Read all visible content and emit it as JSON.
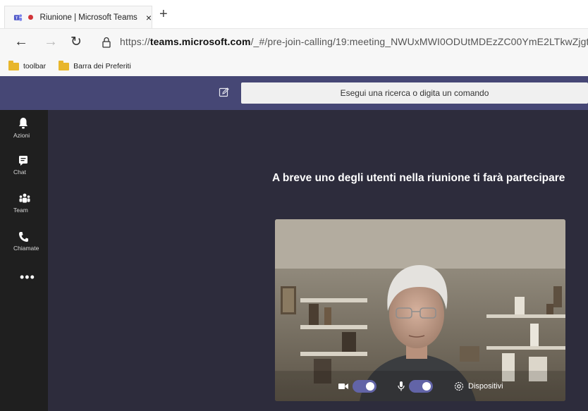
{
  "browser": {
    "tab_title": "Riunione | Microsoft Teams",
    "tab_close": "×",
    "new_tab": "+",
    "url_prefix": "https://",
    "url_domain": "teams.microsoft.com",
    "url_path": "/_#/pre-join-calling/19:meeting_NWUxMWI0ODUtMDEzZC00YmE2LTkwZjgtZTQ5",
    "back_glyph": "←",
    "forward_glyph": "→",
    "reload_glyph": "↻",
    "favorites": [
      {
        "label": "toolbar",
        "icon": "folder-icon"
      },
      {
        "label": "Barra dei Preferiti",
        "icon": "folder-icon"
      }
    ]
  },
  "teams": {
    "search_placeholder": "Esegui una ricerca o digita un comando",
    "rail": [
      {
        "label": "Azioni",
        "icon": "bell-icon"
      },
      {
        "label": "Chat",
        "icon": "chat-icon"
      },
      {
        "label": "Team",
        "icon": "team-icon"
      },
      {
        "label": "Chiamate",
        "icon": "phone-icon"
      }
    ],
    "more_glyph": "•••",
    "headline": "A breve uno degli utenti nella riunione ti farà partecipare",
    "controls": {
      "camera_on": true,
      "mic_on": true,
      "devices_label": "Dispositivi"
    }
  },
  "colors": {
    "teams_purple": "#464775",
    "accent": "#6264a7",
    "rail_bg": "#1f1f1f",
    "main_bg": "#2d2c3c",
    "record_dot": "#d13438"
  }
}
